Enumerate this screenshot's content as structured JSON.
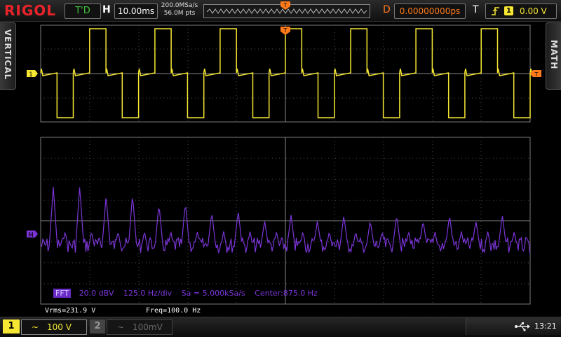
{
  "header": {
    "logo": "RIGOL",
    "run_state": "T'D",
    "horizontal_label": "H",
    "timebase": "10.00ms",
    "sample_rate": "200.0MSa/s",
    "memory_depth": "56.0M pts",
    "delay_label": "D",
    "delay_value": "0.00000000ps",
    "trigger_label": "T",
    "trigger_source": "1",
    "trigger_level": "0.00 V"
  },
  "side_tabs": {
    "left": "VERTICAL",
    "right": "MATH"
  },
  "markers": {
    "ch1": "1",
    "math": "M",
    "trigger_pos": "T",
    "trigger_level": "T"
  },
  "fft": {
    "tag": "FFT",
    "scale": "20.0 dBV",
    "span": "125.0 Hz/div",
    "sample": "Sa = 5.000kSa/s",
    "center": "Center:875.0 Hz"
  },
  "measurements": {
    "vrms": "Vrms=231.9 V",
    "freq": "Freq=100.0 Hz"
  },
  "channels": [
    {
      "number": "1",
      "coupling": "~",
      "scale": "100 V"
    },
    {
      "number": "2",
      "coupling": "~",
      "scale": "100mV"
    }
  ],
  "status": {
    "clock": "13:21"
  },
  "colors": {
    "ch1": "#f6e733",
    "math": "#7b35d8",
    "trigger": "#ff7a1a",
    "logo": "#e8232a"
  },
  "waveforms": {
    "square_wave_cycles": 7.5,
    "fft_peak_count": 18
  }
}
